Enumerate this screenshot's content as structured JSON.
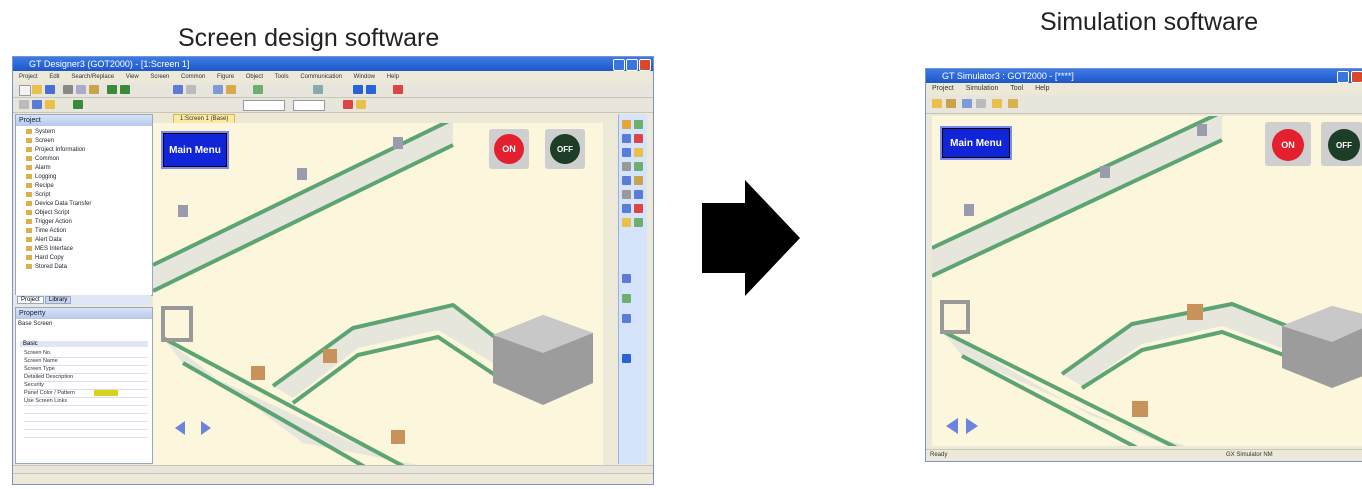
{
  "captions": {
    "left": "Screen design software",
    "right": "Simulation software"
  },
  "arrow_icon": "right-arrow-icon",
  "designer": {
    "title": "GT Designer3 (GOT2000) - [1:Screen 1]",
    "menu": [
      "Project",
      "Edit",
      "Search/Replace",
      "View",
      "Screen",
      "Common",
      "Figure",
      "Object",
      "Tools",
      "Communication",
      "Window",
      "Help"
    ],
    "project_panel": {
      "title": "Project",
      "items": [
        "System",
        "Screen",
        "Project Information",
        "Common",
        "Alarm",
        "Logging",
        "Recipe",
        "Script",
        "Device Data Transfer",
        "Object Script",
        "Trigger Action",
        "Time Action",
        "Alert Data",
        "MES Interface",
        "Hard Copy",
        "Stored Data"
      ],
      "tabs": [
        "Project",
        "Library"
      ]
    },
    "properties_panel": {
      "title": "Property",
      "subtitle": "Base Screen",
      "section": "Basic",
      "rows": [
        "Screen No.",
        "Screen Name",
        "Screen Type",
        "Detailed Description",
        "Security",
        "Panel Color / Pattern",
        "Use Screen Links",
        "",
        "",
        "",
        ""
      ]
    },
    "screen_tab": "1:Screen 1 (Base)",
    "main_menu_label": "Main Menu",
    "lamp_on": "ON",
    "lamp_off": "OFF"
  },
  "simulator": {
    "title": "GT Simulator3 : GOT2000 - [****]",
    "menu": [
      "Project",
      "Simulation",
      "Tool",
      "Help"
    ],
    "main_menu_label": "Main Menu",
    "lamp_on": "ON",
    "lamp_off": "OFF",
    "status_left": "Ready",
    "status_right": "GX Simulator NM"
  },
  "colors": {
    "window_title_blue": "#2a63d6",
    "main_menu_blue": "#1024d8",
    "lamp_red": "#e5202e",
    "lamp_dark_green": "#1e3d28",
    "conveyor_green": "#5da474",
    "canvas_cream": "#fbf6dc"
  }
}
